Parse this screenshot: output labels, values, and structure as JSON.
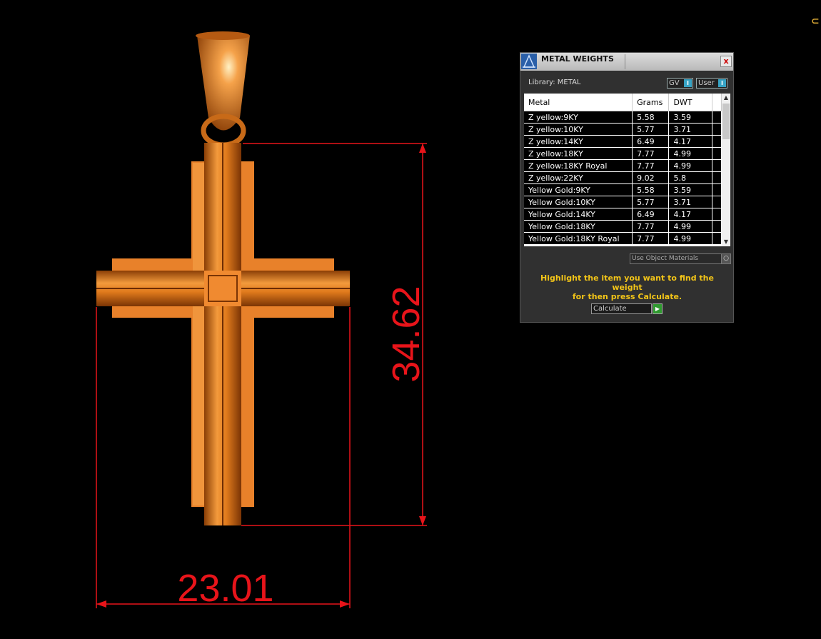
{
  "viewport": {
    "dimensions": {
      "width_label": "23.01",
      "height_label": "34.62"
    },
    "model": "cross-pendant",
    "colors": {
      "metal": "#e07a1c",
      "dimension": "#e8141a",
      "background": "#000000"
    }
  },
  "panel": {
    "title": "METAL WEIGHTS",
    "close_label": "x",
    "library_label": "Library: METAL",
    "toggle_gv": "GV",
    "toggle_user": "User",
    "toggle_switch": "I",
    "columns": [
      "Metal",
      "Grams",
      "DWT"
    ],
    "rows": [
      {
        "metal": "Z yellow:9KY",
        "grams": "5.58",
        "dwt": "3.59"
      },
      {
        "metal": "Z yellow:10KY",
        "grams": "5.77",
        "dwt": "3.71"
      },
      {
        "metal": "Z yellow:14KY",
        "grams": "6.49",
        "dwt": "4.17"
      },
      {
        "metal": "Z yellow:18KY",
        "grams": "7.77",
        "dwt": "4.99"
      },
      {
        "metal": "Z yellow:18KY Royal",
        "grams": "7.77",
        "dwt": "4.99"
      },
      {
        "metal": "Z yellow:22KY",
        "grams": "9.02",
        "dwt": "5.8"
      },
      {
        "metal": "Yellow Gold:9KY",
        "grams": "5.58",
        "dwt": "3.59"
      },
      {
        "metal": "Yellow Gold:10KY",
        "grams": "5.77",
        "dwt": "3.71"
      },
      {
        "metal": "Yellow Gold:14KY",
        "grams": "6.49",
        "dwt": "4.17"
      },
      {
        "metal": "Yellow Gold:18KY",
        "grams": "7.77",
        "dwt": "4.99"
      },
      {
        "metal": "Yellow Gold:18KY Royal",
        "grams": "7.77",
        "dwt": "4.99"
      }
    ],
    "use_object_materials": "Use Object Materials",
    "hint_line1": "Highlight the item you want to find the weight",
    "hint_line2": "for then press Calculate.",
    "calculate_label": "Calculate",
    "colors": {
      "hint": "#f2c418",
      "accent": "#37a3c4",
      "go": "#2f9a2f"
    }
  }
}
